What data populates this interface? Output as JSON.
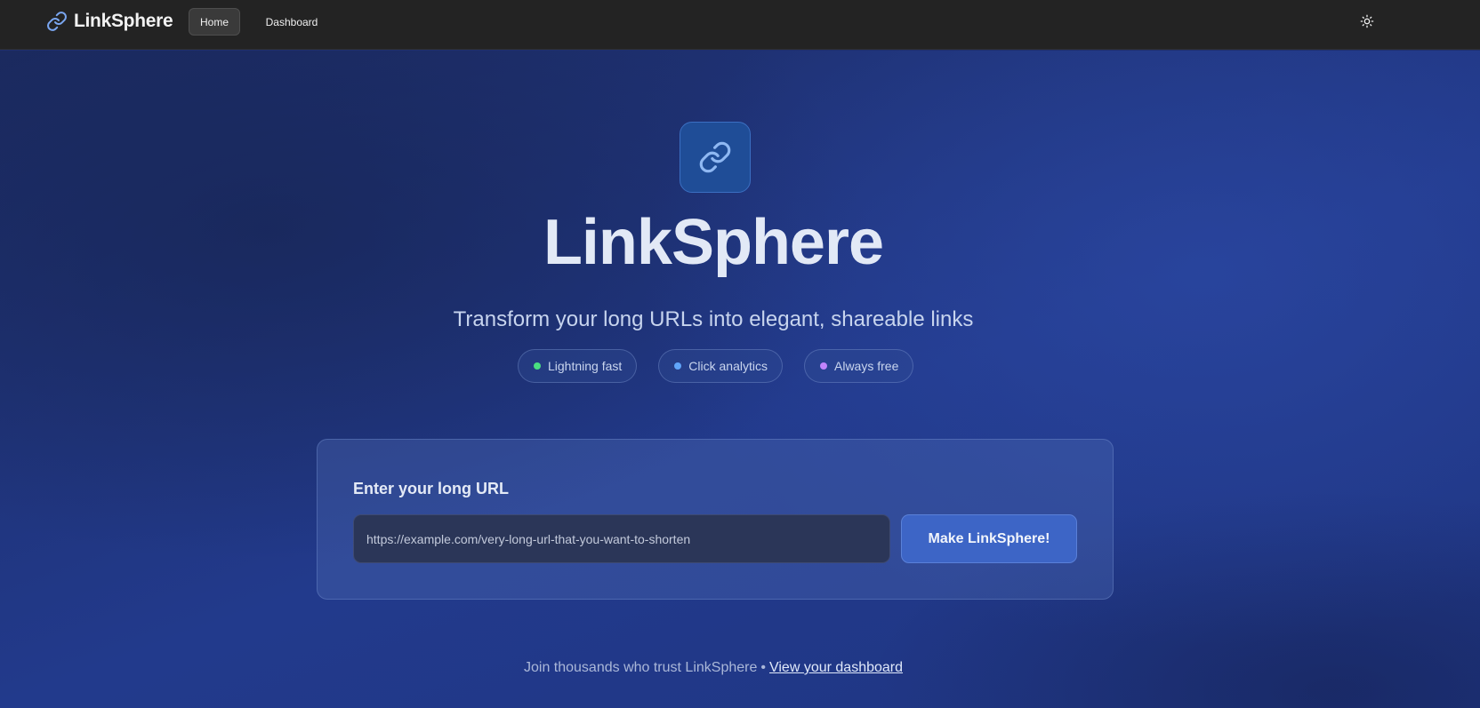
{
  "nav": {
    "brand": "LinkSphere",
    "items": [
      {
        "label": "Home",
        "active": true
      },
      {
        "label": "Dashboard",
        "active": false
      }
    ],
    "theme_toggle_icon": "sun-icon"
  },
  "hero": {
    "logo_icon": "link-icon",
    "title": "LinkSphere",
    "subtitle": "Transform your long URLs into elegant, shareable links",
    "features": [
      {
        "label": "Lightning fast",
        "dot_color": "#4ade80"
      },
      {
        "label": "Click analytics",
        "dot_color": "#60a5fa"
      },
      {
        "label": "Always free",
        "dot_color": "#c084fc"
      }
    ]
  },
  "form": {
    "label": "Enter your long URL",
    "placeholder": "https://example.com/very-long-url-that-you-want-to-shorten",
    "value": "",
    "submit_label": "Make LinkSphere!"
  },
  "footer": {
    "text": "Join thousands who trust LinkSphere",
    "separator": "•",
    "link_label": "View your dashboard"
  },
  "colors": {
    "accent": "#3d65c6",
    "nav_background": "#232323"
  }
}
